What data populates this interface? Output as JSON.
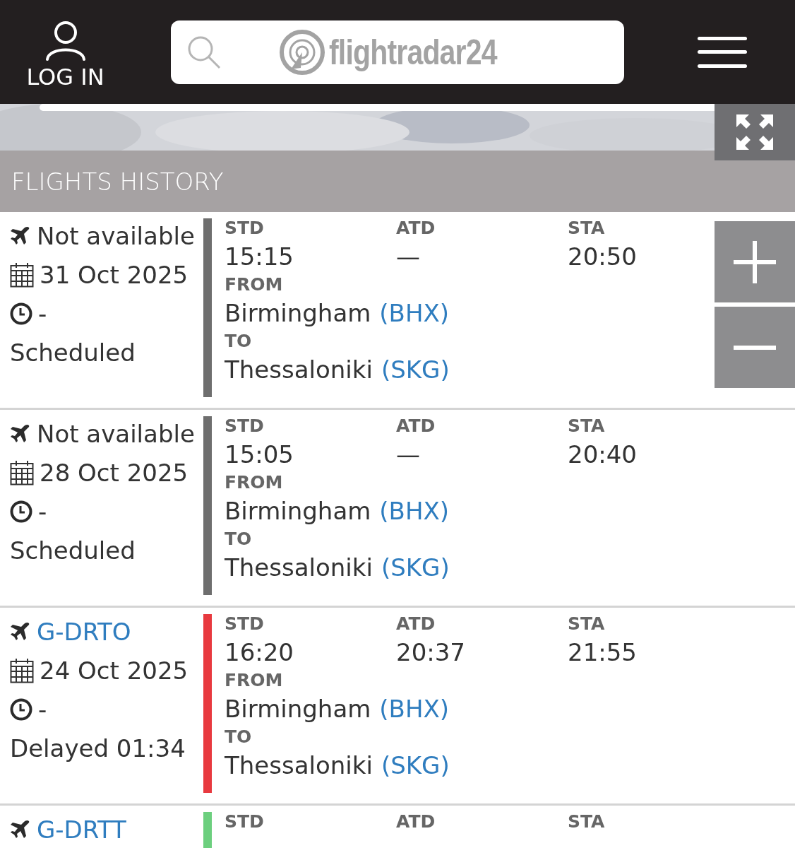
{
  "header": {
    "login_label": "LOG IN",
    "logo_text": "flightradar24"
  },
  "section_title": "FLIGHTS HISTORY",
  "flights": [
    {
      "aircraft": "Not available",
      "aircraft_linked": false,
      "date": "31 Oct 2025",
      "time": "-",
      "status": "Scheduled",
      "color": "#6e6e6e",
      "std_label": "STD",
      "std": "15:15",
      "atd_label": "ATD",
      "atd": "—",
      "sta_label": "STA",
      "sta": "20:50",
      "from_label": "FROM",
      "from_city": "Birmingham",
      "from_code": "(BHX)",
      "to_label": "TO",
      "to_city": "Thessaloniki",
      "to_code": "(SKG)"
    },
    {
      "aircraft": "Not available",
      "aircraft_linked": false,
      "date": "28 Oct 2025",
      "time": "-",
      "status": "Scheduled",
      "color": "#6e6e6e",
      "std_label": "STD",
      "std": "15:05",
      "atd_label": "ATD",
      "atd": "—",
      "sta_label": "STA",
      "sta": "20:40",
      "from_label": "FROM",
      "from_city": "Birmingham",
      "from_code": "(BHX)",
      "to_label": "TO",
      "to_city": "Thessaloniki",
      "to_code": "(SKG)"
    },
    {
      "aircraft": "G-DRTO",
      "aircraft_linked": true,
      "date": "24 Oct 2025",
      "time": "-",
      "status": "Delayed 01:34",
      "color": "#e8393f",
      "std_label": "STD",
      "std": "16:20",
      "atd_label": "ATD",
      "atd": "20:37",
      "sta_label": "STA",
      "sta": "21:55",
      "from_label": "FROM",
      "from_city": "Birmingham",
      "from_code": "(BHX)",
      "to_label": "TO",
      "to_city": "Thessaloniki",
      "to_code": "(SKG)"
    },
    {
      "aircraft": "G-DRTT",
      "aircraft_linked": true,
      "color": "#6ccf7e",
      "std_label": "STD",
      "atd_label": "ATD",
      "sta_label": "STA"
    }
  ]
}
